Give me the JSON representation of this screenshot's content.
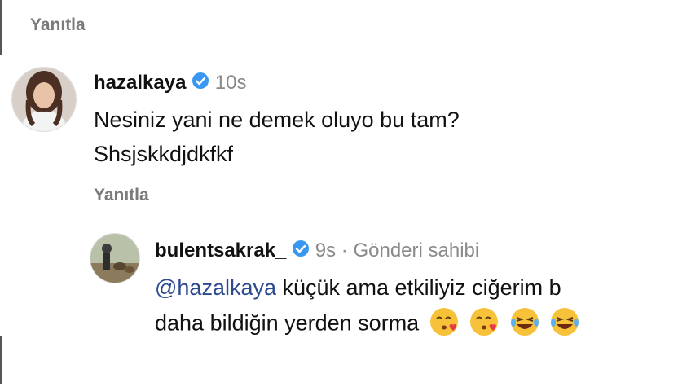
{
  "top_reply": {
    "label": "Yanıtla"
  },
  "comment1": {
    "username": "hazalkaya",
    "time": "10s",
    "text_line1": "Nesiniz yani ne demek oluyo bu tam?",
    "text_line2": "Shsjskkdjdkfkf",
    "reply_label": "Yanıtla"
  },
  "comment2": {
    "username": "bulentsakrak_",
    "time": "9s",
    "separator": "·",
    "owner_label": "Gönderi sahibi",
    "mention": "@hazalkaya",
    "text_line1_rest": " küçük ama etkiliyiz ciğerim b",
    "text_line2": "daha bildiğin yerden sorma",
    "emojis": [
      "kissing-heart-emoji",
      "kissing-heart-emoji",
      "laughing-tears-emoji",
      "laughing-tears-emoji"
    ]
  },
  "colors": {
    "verified": "#3897f0",
    "mention": "#2c4a8e",
    "muted": "#8a8a8a"
  }
}
